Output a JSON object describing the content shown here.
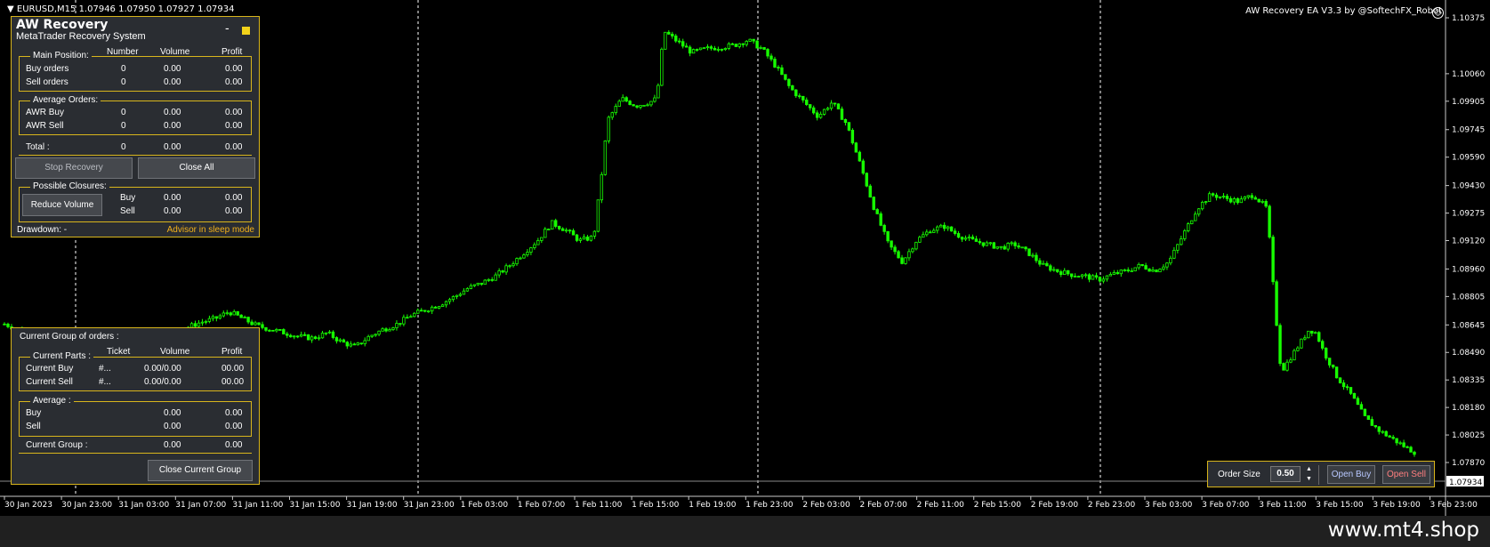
{
  "header": {
    "symbol": "EURUSD,M15",
    "ohlc": "1.07946 1.07950 1.07927 1.07934"
  },
  "ea_credit": "AW Recovery EA  V3.3 by @SoftechFX_Robot",
  "footer_brand": "www.mt4.shop",
  "colors": {
    "candle": "#17ff00",
    "panel_border": "#d8b51c",
    "panel_bg": "#2a2d32",
    "status": "#f2b01a",
    "sell": "#ff7f7f",
    "buy": "#b8c8ff"
  },
  "price_axis": {
    "labels": [
      "1.10375",
      "1.10060",
      "1.09905",
      "1.09745",
      "1.09590",
      "1.09430",
      "1.09275",
      "1.09120",
      "1.08960",
      "1.08805",
      "1.08645",
      "1.08490",
      "1.08335",
      "1.08180",
      "1.08025",
      "1.07870"
    ],
    "current": "1.07934"
  },
  "time_axis": {
    "labels": [
      "30 Jan 2023",
      "30 Jan 23:00",
      "31 Jan 03:00",
      "31 Jan 07:00",
      "31 Jan 11:00",
      "31 Jan 15:00",
      "31 Jan 19:00",
      "31 Jan 23:00",
      "1 Feb 03:00",
      "1 Feb 07:00",
      "1 Feb 11:00",
      "1 Feb 15:00",
      "1 Feb 19:00",
      "1 Feb 23:00",
      "2 Feb 03:00",
      "2 Feb 07:00",
      "2 Feb 11:00",
      "2 Feb 15:00",
      "2 Feb 19:00",
      "2 Feb 23:00",
      "3 Feb 03:00",
      "3 Feb 07:00",
      "3 Feb 11:00",
      "3 Feb 15:00",
      "3 Feb 19:00",
      "3 Feb 23:00"
    ]
  },
  "price_path": [
    [
      0,
      1.0865
    ],
    [
      2,
      1.0862
    ],
    [
      4,
      1.0857
    ],
    [
      6,
      1.085
    ],
    [
      8,
      1.084
    ],
    [
      10,
      1.083
    ],
    [
      12,
      1.0822
    ],
    [
      14,
      1.0825
    ],
    [
      16,
      1.083
    ],
    [
      18,
      1.0836
    ],
    [
      20,
      1.0843
    ],
    [
      22,
      1.0853
    ],
    [
      24,
      1.086
    ],
    [
      26,
      1.0863
    ],
    [
      28,
      1.0866
    ],
    [
      30,
      1.0868
    ],
    [
      32,
      1.0872
    ],
    [
      34,
      1.0868
    ],
    [
      36,
      1.0864
    ],
    [
      38,
      1.0862
    ],
    [
      40,
      1.086
    ],
    [
      42,
      1.0858
    ],
    [
      44,
      1.0857
    ],
    [
      46,
      1.086
    ],
    [
      48,
      1.0855
    ],
    [
      50,
      1.0852
    ],
    [
      52,
      1.0858
    ],
    [
      54,
      1.0862
    ],
    [
      56,
      1.0865
    ],
    [
      58,
      1.087
    ],
    [
      60,
      1.0873
    ],
    [
      62,
      1.0876
    ],
    [
      64,
      1.088
    ],
    [
      66,
      1.0885
    ],
    [
      68,
      1.0888
    ],
    [
      70,
      1.0892
    ],
    [
      72,
      1.0898
    ],
    [
      74,
      1.0905
    ],
    [
      76,
      1.0912
    ],
    [
      78,
      1.0922
    ],
    [
      80,
      1.0918
    ],
    [
      82,
      1.0912
    ],
    [
      84,
      1.0914
    ],
    [
      85,
      1.0945
    ],
    [
      86,
      1.098
    ],
    [
      88,
      1.0992
    ],
    [
      90,
      1.0988
    ],
    [
      92,
      1.099
    ],
    [
      93,
      1.0992
    ],
    [
      94,
      1.103
    ],
    [
      96,
      1.1024
    ],
    [
      98,
      1.1018
    ],
    [
      100,
      1.102
    ],
    [
      102,
      1.1021
    ],
    [
      104,
      1.1022
    ],
    [
      106,
      1.1025
    ],
    [
      108,
      1.102
    ],
    [
      110,
      1.101
    ],
    [
      112,
      1.0998
    ],
    [
      114,
      1.099
    ],
    [
      116,
      1.0982
    ],
    [
      118,
      1.099
    ],
    [
      120,
      1.0978
    ],
    [
      122,
      1.0955
    ],
    [
      124,
      1.093
    ],
    [
      126,
      1.091
    ],
    [
      128,
      1.09
    ],
    [
      130,
      1.0912
    ],
    [
      132,
      1.0918
    ],
    [
      134,
      1.092
    ],
    [
      136,
      1.0915
    ],
    [
      138,
      1.0912
    ],
    [
      140,
      1.091
    ],
    [
      142,
      1.0908
    ],
    [
      144,
      1.091
    ],
    [
      146,
      1.0905
    ],
    [
      148,
      1.0898
    ],
    [
      150,
      1.0895
    ],
    [
      152,
      1.0893
    ],
    [
      154,
      1.0892
    ],
    [
      156,
      1.089
    ],
    [
      158,
      1.0893
    ],
    [
      160,
      1.0895
    ],
    [
      162,
      1.0898
    ],
    [
      164,
      1.0895
    ],
    [
      166,
      1.09
    ],
    [
      168,
      1.0915
    ],
    [
      170,
      1.093
    ],
    [
      172,
      1.0938
    ],
    [
      174,
      1.0936
    ],
    [
      176,
      1.0934
    ],
    [
      178,
      1.0938
    ],
    [
      180,
      1.093
    ],
    [
      181,
      1.088
    ],
    [
      182,
      1.0838
    ],
    [
      184,
      1.085
    ],
    [
      186,
      1.0862
    ],
    [
      187,
      1.086
    ],
    [
      188,
      1.085
    ],
    [
      190,
      1.0835
    ],
    [
      192,
      1.0825
    ],
    [
      194,
      1.0812
    ],
    [
      196,
      1.0805
    ],
    [
      198,
      1.08
    ],
    [
      200,
      1.0795
    ],
    [
      201,
      1.0793
    ]
  ],
  "panel_main": {
    "title": "AW Recovery",
    "subtitle": "MetaTrader Recovery System",
    "minimize": "-",
    "col_number": "Number",
    "col_volume": "Volume",
    "col_profit": "Profit",
    "main_position": {
      "label": "Main Position:",
      "rows": [
        {
          "label": "Buy orders",
          "number": "0",
          "volume": "0.00",
          "profit": "0.00"
        },
        {
          "label": "Sell orders",
          "number": "0",
          "volume": "0.00",
          "profit": "0.00"
        }
      ]
    },
    "average_orders": {
      "label": "Average Orders:",
      "rows": [
        {
          "label": "AWR Buy",
          "number": "0",
          "volume": "0.00",
          "profit": "0.00"
        },
        {
          "label": "AWR Sell",
          "number": "0",
          "volume": "0.00",
          "profit": "0.00"
        }
      ]
    },
    "total": {
      "label": "Total :",
      "number": "0",
      "volume": "0.00",
      "profit": "0.00"
    },
    "stop_recovery": "Stop Recovery",
    "close_all": "Close All",
    "possible_closures": {
      "label": "Possible Closures:",
      "reduce_volume": "Reduce Volume",
      "rows": [
        {
          "label": "Buy",
          "volume": "0.00",
          "profit": "0.00"
        },
        {
          "label": "Sell",
          "volume": "0.00",
          "profit": "0.00"
        }
      ]
    },
    "drawdown": "Drawdown: -",
    "status": "Advisor in sleep mode"
  },
  "panel_group": {
    "title": "Current Group of orders :",
    "col_ticket": "Ticket",
    "col_volume": "Volume",
    "col_profit": "Profit",
    "current_parts": {
      "label": "Current Parts :",
      "rows": [
        {
          "label": "Current Buy",
          "ticket": "#...",
          "volume": "0.00/0.00",
          "profit": "00.00"
        },
        {
          "label": "Current Sell",
          "ticket": "#...",
          "volume": "0.00/0.00",
          "profit": "00.00"
        }
      ]
    },
    "average": {
      "label": "Average :",
      "rows": [
        {
          "label": "Buy",
          "volume": "0.00",
          "profit": "0.00"
        },
        {
          "label": "Sell",
          "volume": "0.00",
          "profit": "0.00"
        }
      ]
    },
    "current_group": {
      "label": "Current Group :",
      "volume": "0.00",
      "profit": "0.00"
    },
    "close_current_group": "Close Current Group"
  },
  "order_panel": {
    "label": "Order Size",
    "value": "0.50",
    "open_buy": "Open Buy",
    "open_sell": "Open Sell"
  }
}
